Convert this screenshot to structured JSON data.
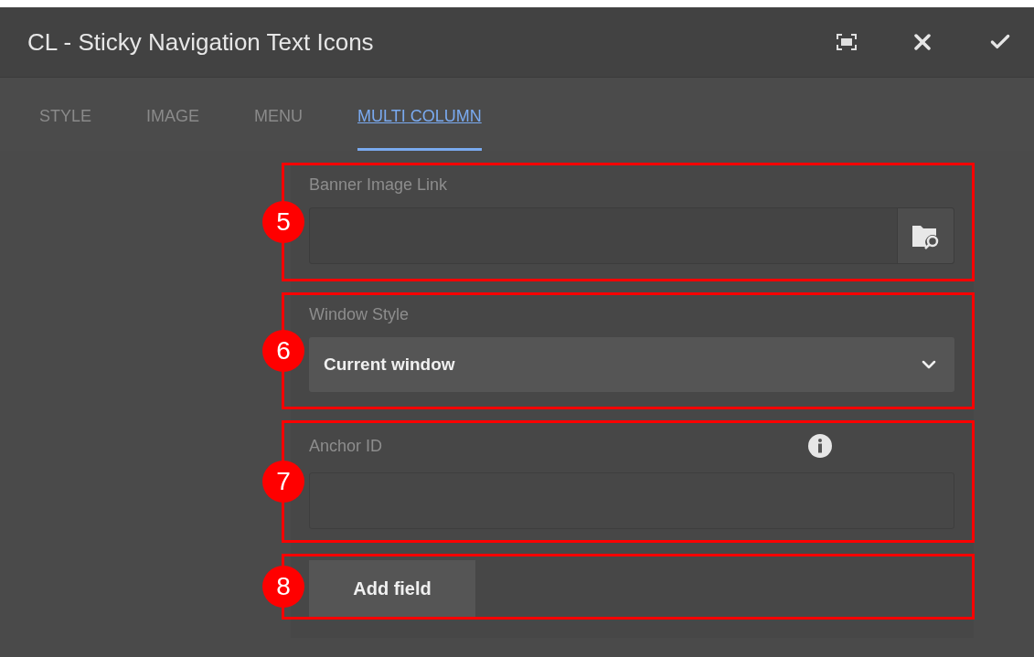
{
  "dialog": {
    "title": "CL - Sticky Navigation Text Icons"
  },
  "tabs": [
    {
      "label": "STYLE",
      "selected": false
    },
    {
      "label": "IMAGE",
      "selected": false
    },
    {
      "label": "MENU",
      "selected": false
    },
    {
      "label": "MULTI COLUMN",
      "selected": true
    }
  ],
  "sections": [
    {
      "callout": "5",
      "kind": "pathfield",
      "label": "Banner Image Link"
    },
    {
      "callout": "6",
      "kind": "select",
      "label": "Window Style",
      "value": "Current window"
    },
    {
      "callout": "7",
      "kind": "textfield",
      "label": "Anchor ID",
      "info": true
    },
    {
      "callout": "8",
      "kind": "button",
      "label": "Add field"
    }
  ]
}
